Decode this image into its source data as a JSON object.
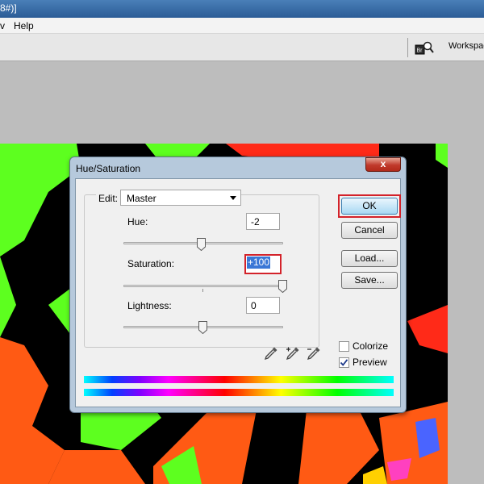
{
  "window": {
    "title_fragment": "8#)]"
  },
  "menubar": {
    "items": [
      {
        "label": "v"
      },
      {
        "label": "Help"
      }
    ]
  },
  "optionsbar": {
    "workspace_label": "Workspac"
  },
  "dialog": {
    "title": "Hue/Saturation",
    "close_symbol": "x",
    "edit": {
      "label": "Edit:",
      "selected": "Master"
    },
    "hue": {
      "label": "Hue:",
      "value": "-2",
      "slider_level": 0.48
    },
    "saturation": {
      "label": "Saturation:",
      "value": "+100",
      "slider_level": 1.0
    },
    "lightness": {
      "label": "Lightness:",
      "value": "0",
      "slider_level": 0.5
    },
    "buttons": {
      "ok": "OK",
      "cancel": "Cancel",
      "load": "Load...",
      "save": "Save..."
    },
    "checkboxes": {
      "colorize": {
        "label": "Colorize",
        "checked": false
      },
      "preview": {
        "label": "Preview",
        "checked": true
      }
    },
    "eyedroppers": [
      "eyedropper-icon",
      "eyedropper-add-icon",
      "eyedropper-subtract-icon"
    ]
  },
  "colors": {
    "highlight_frame": "#d3222a",
    "selection": "#3a77d6",
    "image_green": "#5dff1f",
    "image_orange": "#ff5a14",
    "image_red": "#ff2a18"
  }
}
